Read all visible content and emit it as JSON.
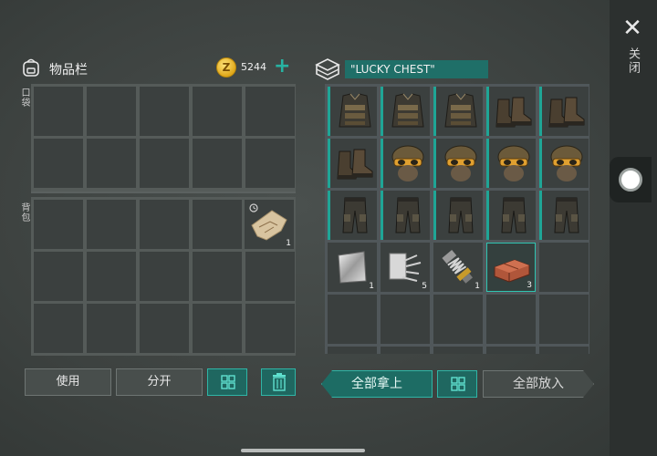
{
  "inventory": {
    "title": "物品栏",
    "coins": "5244",
    "pocket_label": "口袋",
    "backpack_label": "背包",
    "backpack_item_count": "1"
  },
  "buttons": {
    "use": "使用",
    "split": "分开"
  },
  "chest": {
    "title": "\"LUCKY CHEST\"",
    "take_all": "全部拿上",
    "put_all": "全部放入",
    "counts": {
      "metal_sheet": "1",
      "scrap": "5",
      "spring": "1",
      "bricks": "3"
    }
  },
  "sidebar": {
    "close_label": "关闭"
  },
  "icons": {
    "close": "close-icon",
    "bag": "backpack-icon",
    "coin": "coin-icon",
    "chest": "chest-icon",
    "sort": "sort-grid-icon",
    "trash": "trash-icon"
  },
  "colors": {
    "accent": "#27b3a2",
    "accent_dark": "#1f6760",
    "panel_bg": "#3f4443",
    "slot_bg": "#3b403f"
  }
}
